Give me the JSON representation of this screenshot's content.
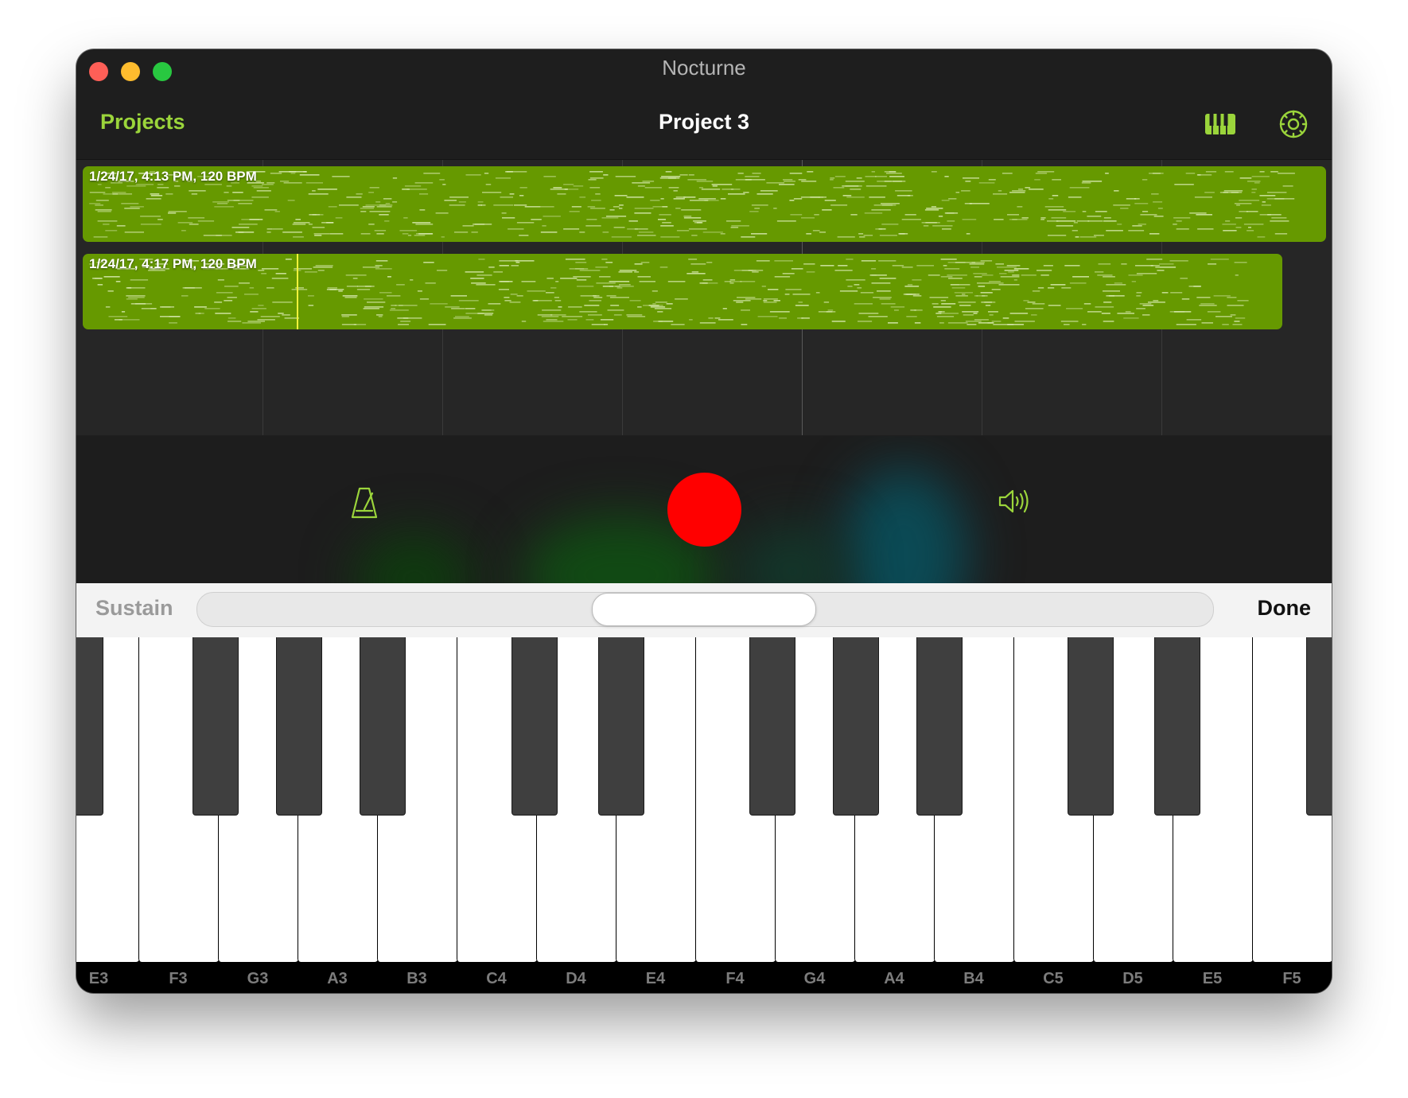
{
  "window": {
    "title": "Nocturne"
  },
  "toolbar": {
    "projects_label": "Projects",
    "project_title": "Project 3",
    "piano_icon": "piano-keys-icon",
    "settings_icon": "gear-icon",
    "accent_color": "#9bd53b"
  },
  "tracks": [
    {
      "label": "1/24/17, 4:13 PM, 120 BPM",
      "color": "#669900"
    },
    {
      "label": "1/24/17, 4:17 PM, 120 BPM",
      "color": "#669900"
    }
  ],
  "transport": {
    "metronome_icon": "metronome-icon",
    "record_color": "#ff0000",
    "speaker_icon": "speaker-volume-icon"
  },
  "sustain": {
    "label": "Sustain",
    "done_label": "Done"
  },
  "keyboard": {
    "white_keys": [
      "E3",
      "F3",
      "G3",
      "A3",
      "B3",
      "C4",
      "D4",
      "E4",
      "F4",
      "G4",
      "A4",
      "B4",
      "C5",
      "D5",
      "E5",
      "F5"
    ]
  }
}
